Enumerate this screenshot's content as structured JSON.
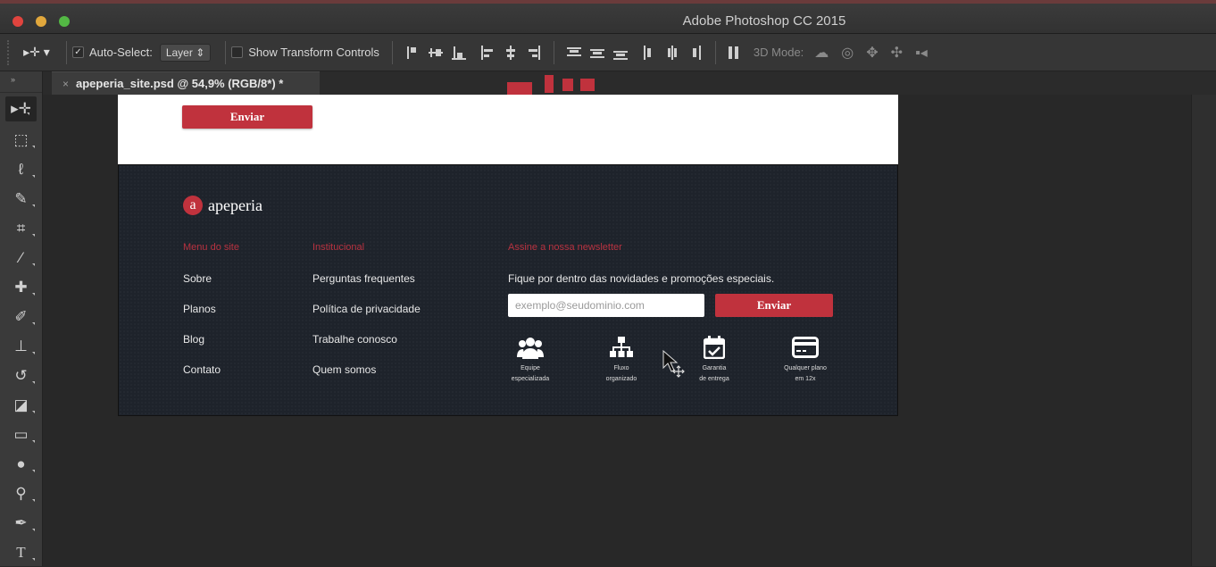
{
  "window": {
    "title": "Adobe Photoshop CC 2015"
  },
  "options": {
    "auto_select_label": "Auto-Select:",
    "auto_select_value": "Layer",
    "show_transform_label": "Show Transform Controls",
    "mode_label": "3D Mode:"
  },
  "document": {
    "tab_title": "apeperia_site.psd @ 54,9% (RGB/8*) *"
  },
  "site": {
    "top_button": "Enviar",
    "brand": {
      "logo_letter": "a",
      "name": "apeperia"
    },
    "menu": {
      "title": "Menu do site",
      "links": [
        "Sobre",
        "Planos",
        "Blog",
        "Contato"
      ]
    },
    "institutional": {
      "title": "Institucional",
      "links": [
        "Perguntas frequentes",
        "Política de privacidade",
        "Trabalhe conosco",
        "Quem somos"
      ]
    },
    "newsletter": {
      "title": "Assine a nossa newsletter",
      "description": "Fique por dentro das novidades e promoções especiais.",
      "placeholder": "exemplo@seudominio.com",
      "button": "Enviar"
    },
    "features": [
      {
        "icon": "team-icon",
        "label_1": "Equipe",
        "label_2": "especializada"
      },
      {
        "icon": "sitemap-icon",
        "label_1": "Fluxo",
        "label_2": "organizado"
      },
      {
        "icon": "calendar-check-icon",
        "label_1": "Garantia",
        "label_2": "de entrega"
      },
      {
        "icon": "credit-card-icon",
        "label_1": "Qualquer plano",
        "label_2": "em 12x"
      }
    ]
  },
  "colors": {
    "brand_red": "#c0323d",
    "footer_bg": "#1e232b"
  }
}
